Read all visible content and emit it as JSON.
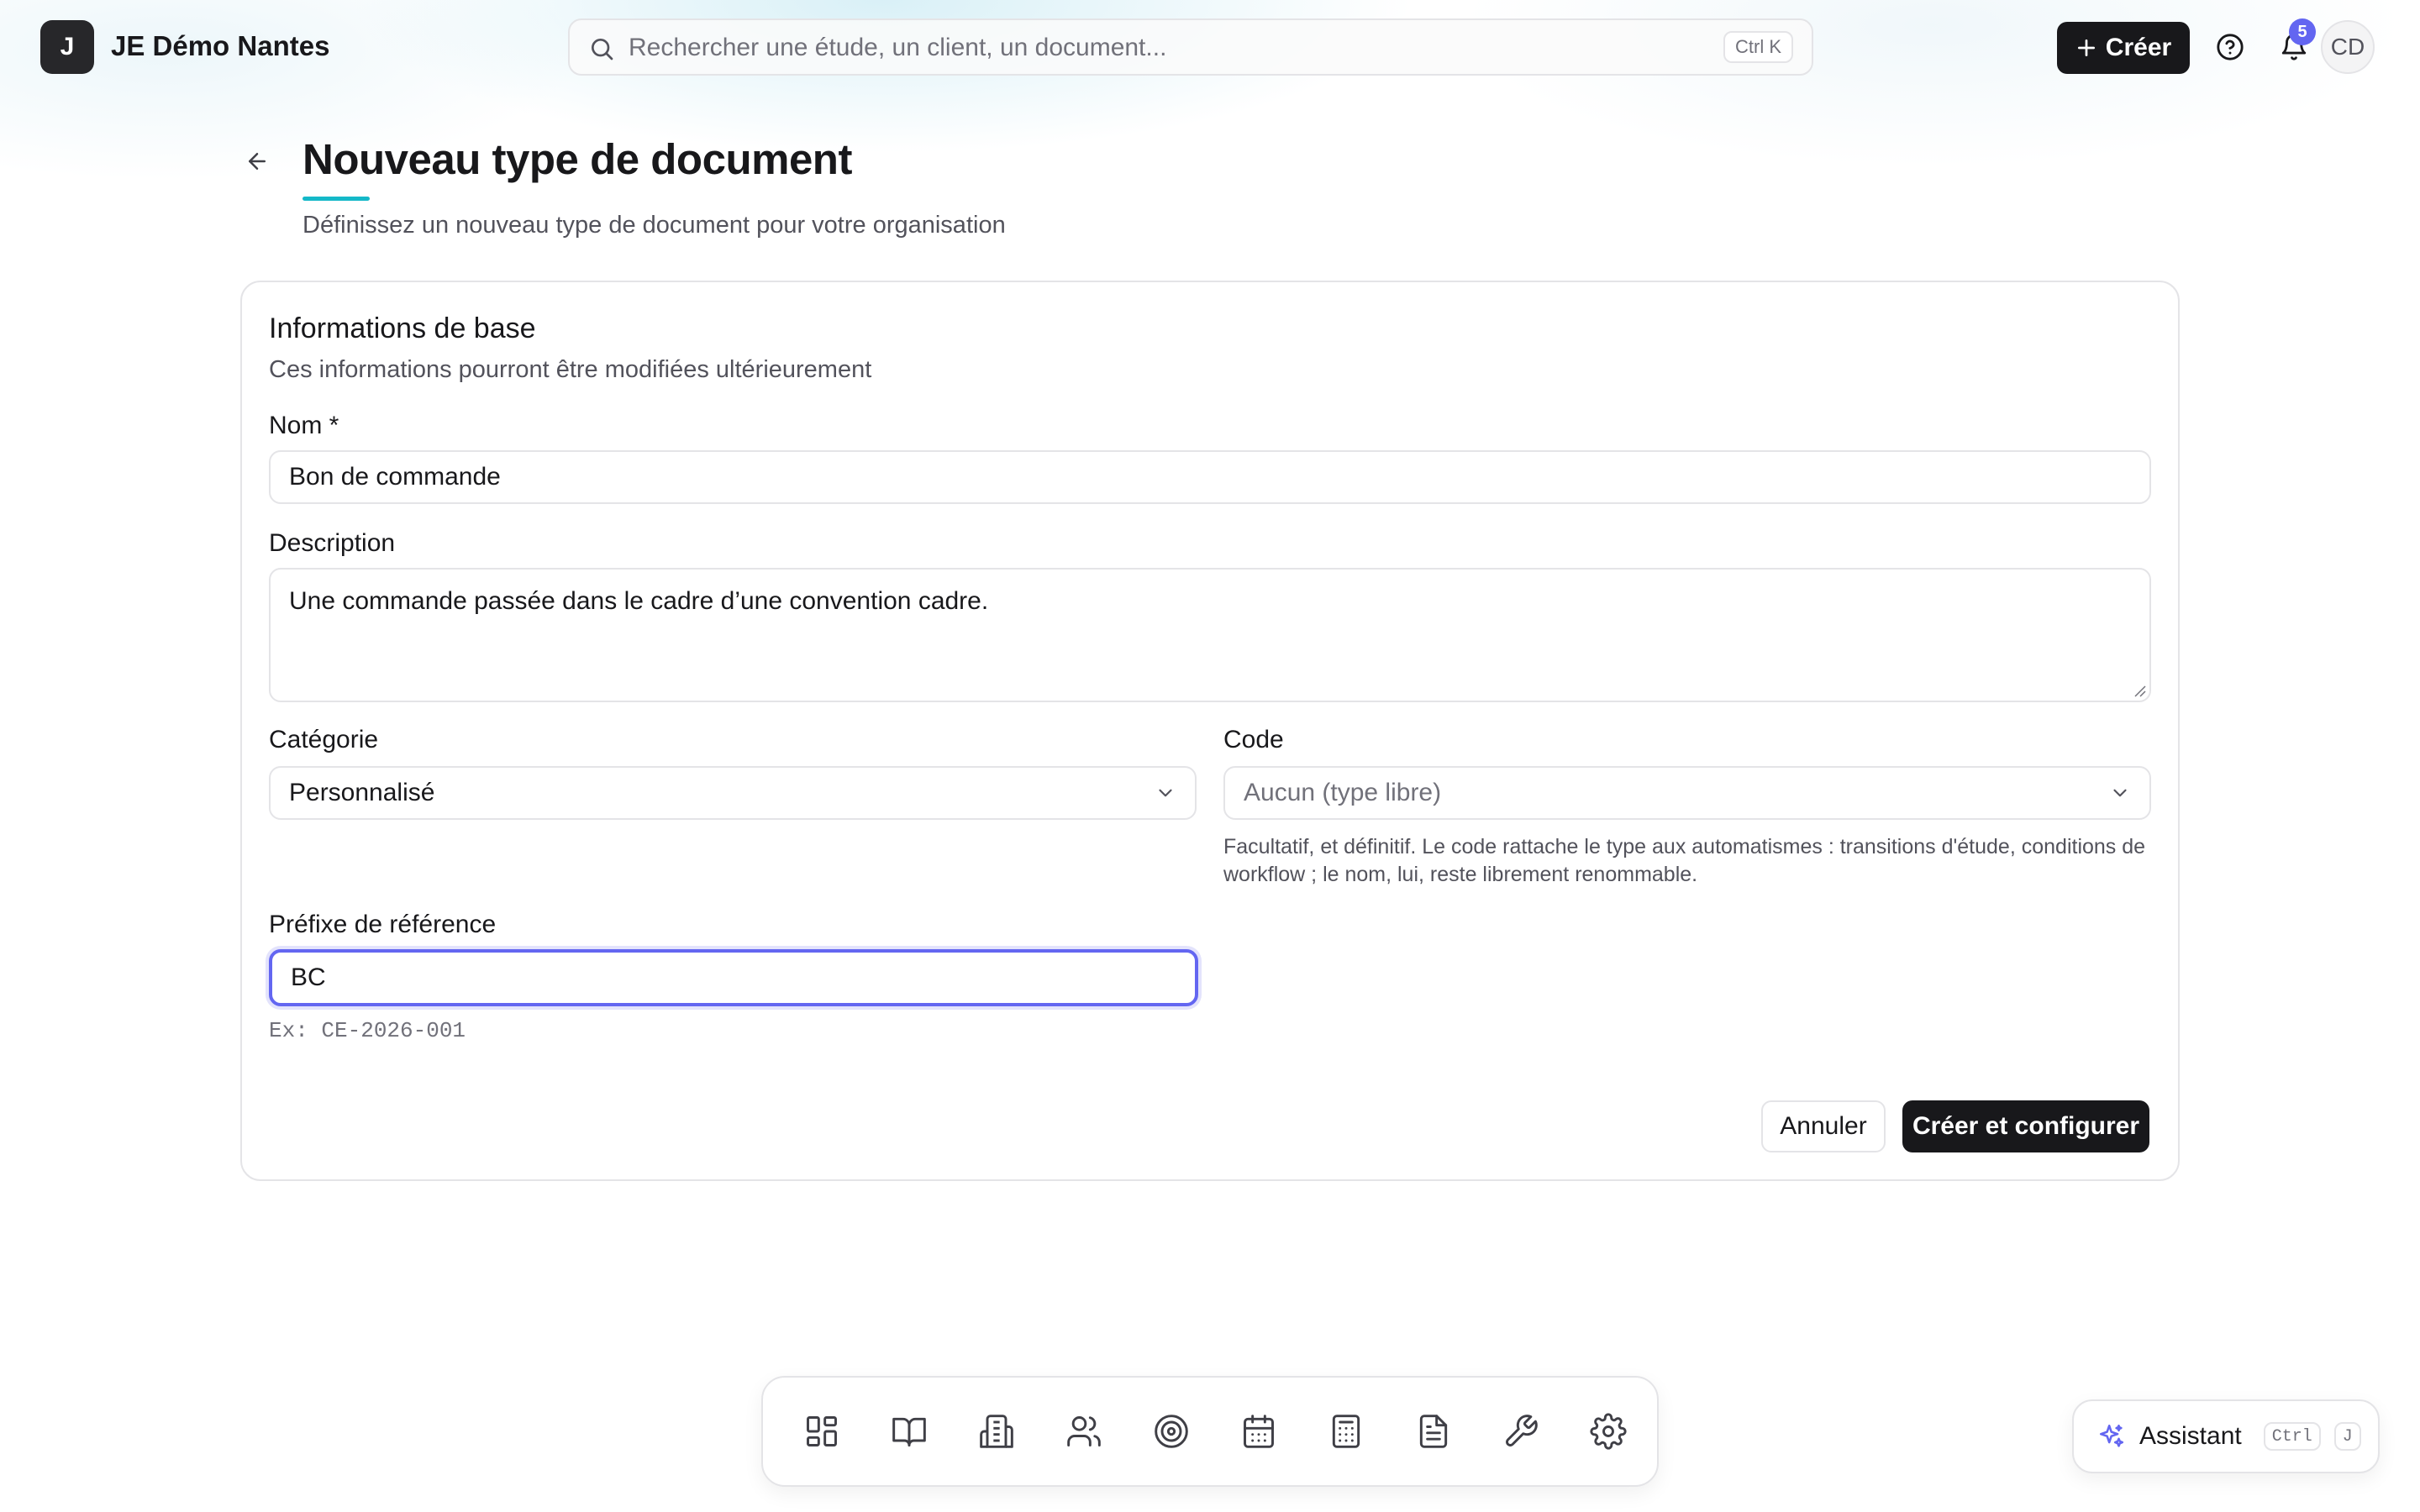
{
  "header": {
    "logo_letter": "J",
    "org_name": "JE Démo Nantes",
    "search_placeholder": "Rechercher une étude, un client, un document...",
    "search_shortcut": "Ctrl K",
    "create_label": "Créer",
    "notification_count": "5",
    "avatar_initials": "CD"
  },
  "page": {
    "title": "Nouveau type de document",
    "subtitle": "Définissez un nouveau type de document pour votre organisation"
  },
  "form": {
    "section_title": "Informations de base",
    "section_desc": "Ces informations pourront être modifiées ultérieurement",
    "name_label": "Nom *",
    "name_value": "Bon de commande",
    "description_label": "Description",
    "description_value": "Une commande passée dans le cadre d’une convention cadre.",
    "category_label": "Catégorie",
    "category_value": "Personnalisé",
    "code_label": "Code",
    "code_placeholder": "Aucun (type libre)",
    "code_help": "Facultatif, et définitif. Le code rattache le type aux automatismes : transitions d'étude, conditions de workflow ; le nom, lui, reste librement renommable.",
    "prefix_label": "Préfixe de référence",
    "prefix_value": "BC",
    "prefix_help": "Ex: CE-2026-001",
    "cancel_label": "Annuler",
    "submit_label": "Créer et configurer"
  },
  "dock": {
    "items": [
      "dashboard-icon",
      "book-icon",
      "building-icon",
      "users-icon",
      "target-icon",
      "calendar-icon",
      "calculator-icon",
      "document-icon",
      "wrench-icon",
      "gear-icon"
    ]
  },
  "assistant": {
    "label": "Assistant",
    "shortcut_key1": "Ctrl",
    "shortcut_key2": "J"
  },
  "colors": {
    "primary": "#18181b",
    "focus_ring": "#6366f1",
    "accent_underline": "#14b8c8",
    "badge": "#6366f1"
  }
}
